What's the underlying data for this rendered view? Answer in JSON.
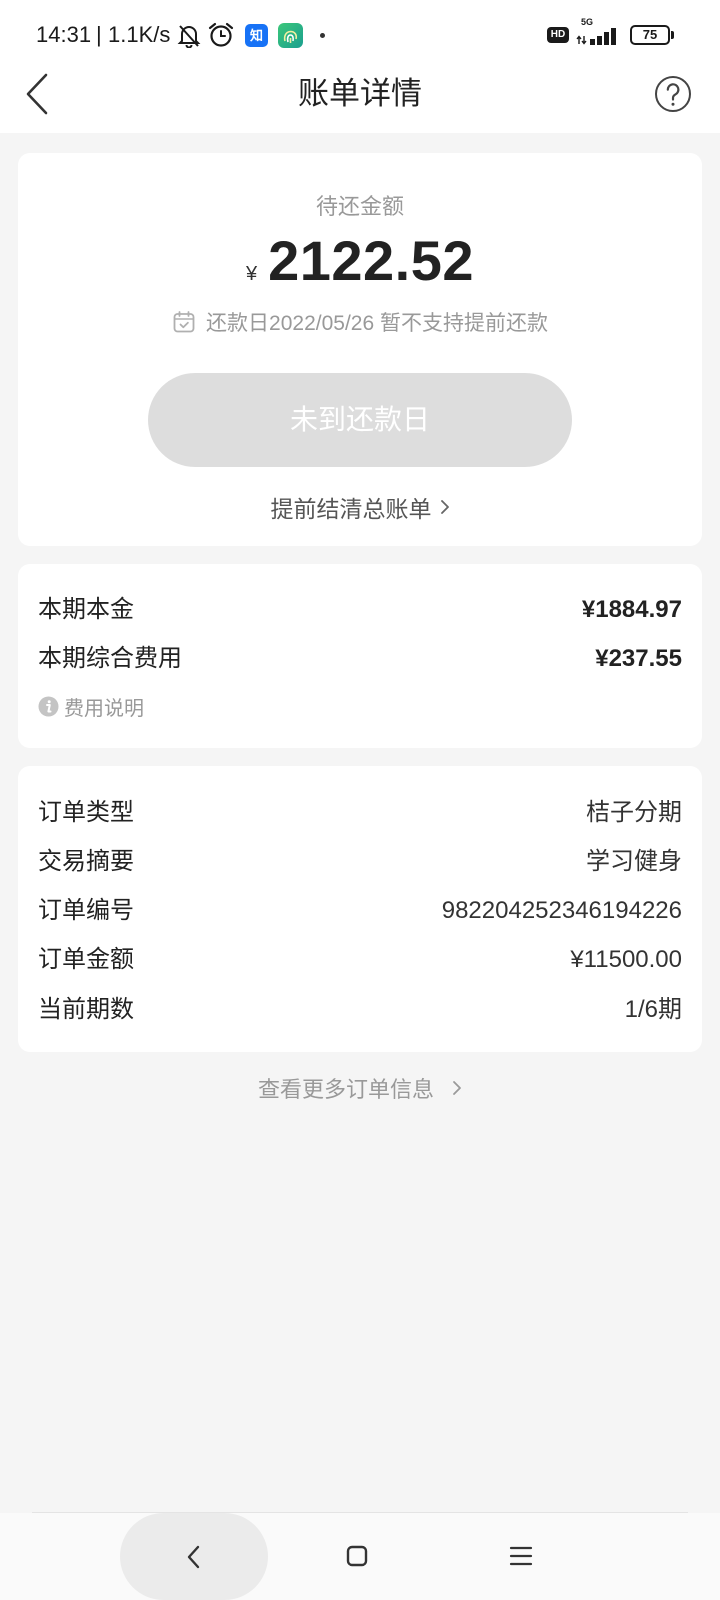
{
  "status_bar": {
    "time": "14:31",
    "separator": "|",
    "net_speed": "1.1K/s",
    "icons": [
      "bell-off-icon",
      "alarm-icon",
      "zhihu-app-icon",
      "green-app-icon",
      "notification-dot"
    ],
    "zhihu_glyph": "知",
    "hd_badge": "HD",
    "network_type": "5G",
    "signal_icon": "signal-bars-icon",
    "battery_level": "75"
  },
  "header": {
    "back_icon": "chevron-left-icon",
    "title": "账单详情",
    "help_icon": "help-circle-icon"
  },
  "summary": {
    "label": "待还金额",
    "currency_symbol": "¥",
    "amount": "2122.52",
    "calendar_icon": "calendar-check-icon",
    "due_text": "还款日2022/05/26 暂不支持提前还款",
    "pay_button_label": "未到还款日",
    "pay_button_disabled": true,
    "settle_link_label": "提前结清总账单",
    "settle_link_icon": "chevron-right-icon"
  },
  "current_period": {
    "rows": [
      {
        "label": "本期本金",
        "value": "¥1884.97"
      },
      {
        "label": "本期综合费用",
        "value": "¥237.55"
      }
    ],
    "fee_info_icon": "info-icon",
    "fee_info_label": "费用说明"
  },
  "order_info": {
    "rows": [
      {
        "label": "订单类型",
        "value": "桔子分期"
      },
      {
        "label": "交易摘要",
        "value": "学习健身"
      },
      {
        "label": "订单编号",
        "value": "982204252346194226"
      },
      {
        "label": "订单金额",
        "value": "¥11500.00"
      },
      {
        "label": "当前期数",
        "value": "1/6期"
      }
    ]
  },
  "more_link": {
    "label": "查看更多订单信息",
    "icon": "chevron-right-icon"
  },
  "nav_bar": {
    "buttons": [
      "back-nav-icon",
      "home-nav-icon",
      "recents-nav-icon"
    ]
  },
  "colors": {
    "page_background": "#f5f5f5",
    "card_background": "#ffffff",
    "disabled_button": "#dddddd",
    "primary_text": "#222222",
    "secondary_text": "#999999",
    "zhihu_blue": "#1772f6"
  }
}
